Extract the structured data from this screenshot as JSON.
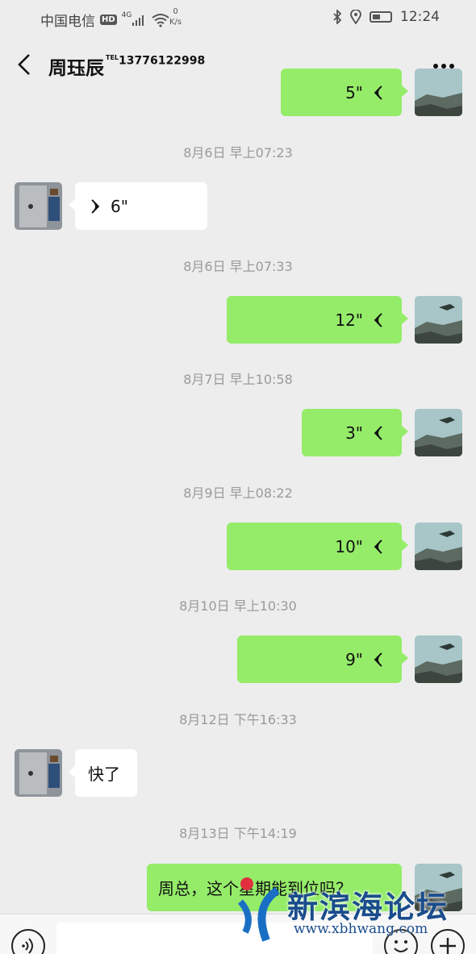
{
  "status_bar": {
    "carrier": "中国电信",
    "hd_badge": "HD",
    "network": "4G",
    "speed_value": "0",
    "speed_unit": "K/s",
    "time": "12:24"
  },
  "header": {
    "title": "周珏辰",
    "tel_prefix": "TEL",
    "phone": "13776122998"
  },
  "messages": [
    {
      "type": "voice",
      "side": "right",
      "duration": "5\""
    },
    {
      "type": "timestamp",
      "text": "8月6日 早上07:23"
    },
    {
      "type": "voice",
      "side": "left",
      "duration": "6\""
    },
    {
      "type": "timestamp",
      "text": "8月6日 早上07:33"
    },
    {
      "type": "voice",
      "side": "right",
      "duration": "12\""
    },
    {
      "type": "timestamp",
      "text": "8月7日 早上10:58"
    },
    {
      "type": "voice",
      "side": "right",
      "duration": "3\""
    },
    {
      "type": "timestamp",
      "text": "8月9日 早上08:22"
    },
    {
      "type": "voice",
      "side": "right",
      "duration": "10\""
    },
    {
      "type": "timestamp",
      "text": "8月10日 早上10:30"
    },
    {
      "type": "voice",
      "side": "right",
      "duration": "9\""
    },
    {
      "type": "timestamp",
      "text": "8月12日 下午16:33"
    },
    {
      "type": "text",
      "side": "left",
      "text": "快了"
    },
    {
      "type": "timestamp",
      "text": "8月13日 下午14:19"
    },
    {
      "type": "text",
      "side": "right",
      "text": "周总，这个星期能到位吗？"
    }
  ],
  "watermark": {
    "name": "新滨海论坛",
    "url": "www.xbhwang.com"
  },
  "colors": {
    "sent_bubble": "#95ec69",
    "received_bubble": "#ffffff",
    "background": "#ededed"
  }
}
